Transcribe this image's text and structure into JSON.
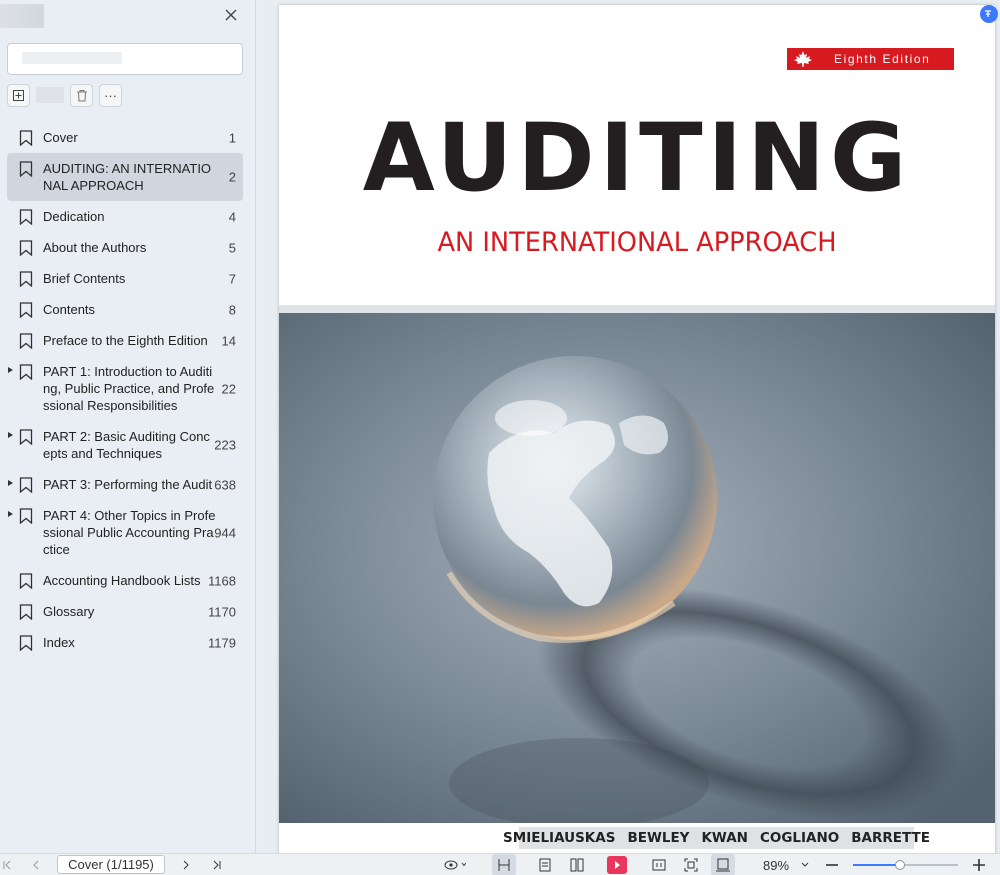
{
  "sidebar": {
    "search_placeholder": "",
    "tools": {
      "more_label": "···"
    },
    "toc": [
      {
        "label": "Cover",
        "page": "1",
        "expandable": false
      },
      {
        "label": "AUDITING: AN INTERNATIONAL APPROACH",
        "page": "2",
        "expandable": false,
        "active": true
      },
      {
        "label": "Dedication",
        "page": "4",
        "expandable": false
      },
      {
        "label": "About the Authors",
        "page": "5",
        "expandable": false
      },
      {
        "label": "Brief Contents",
        "page": "7",
        "expandable": false
      },
      {
        "label": "Contents",
        "page": "8",
        "expandable": false
      },
      {
        "label": "Preface to the Eighth Edition",
        "page": "14",
        "expandable": false
      },
      {
        "label": "PART 1: Introduction to Auditing, Public Practice, and Professional Responsibilities",
        "page": "22",
        "expandable": true
      },
      {
        "label": "PART 2: Basic Auditing Concepts and Techniques",
        "page": "223",
        "expandable": true
      },
      {
        "label": "PART 3: Performing the Audit",
        "page": "638",
        "expandable": true
      },
      {
        "label": "PART 4: Other Topics in Professional Public Accounting Practice",
        "page": "944",
        "expandable": true
      },
      {
        "label": "Accounting Handbook Lists",
        "page": "1168",
        "expandable": false
      },
      {
        "label": "Glossary",
        "page": "1170",
        "expandable": false
      },
      {
        "label": "Index",
        "page": "1179",
        "expandable": false
      }
    ]
  },
  "cover": {
    "edition": "Eighth Edition",
    "title": "AUDITING",
    "subtitle": "AN INTERNATIONAL APPROACH",
    "authors": [
      "SMIELIAUSKAS",
      "BEWLEY",
      "KWAN",
      "COGLIANO",
      "BARRETTE"
    ],
    "accent_color": "#d71920"
  },
  "bottombar": {
    "page_indicator": "Cover (1/1195)",
    "zoom": "89%",
    "zoom_fraction": 0.45
  }
}
